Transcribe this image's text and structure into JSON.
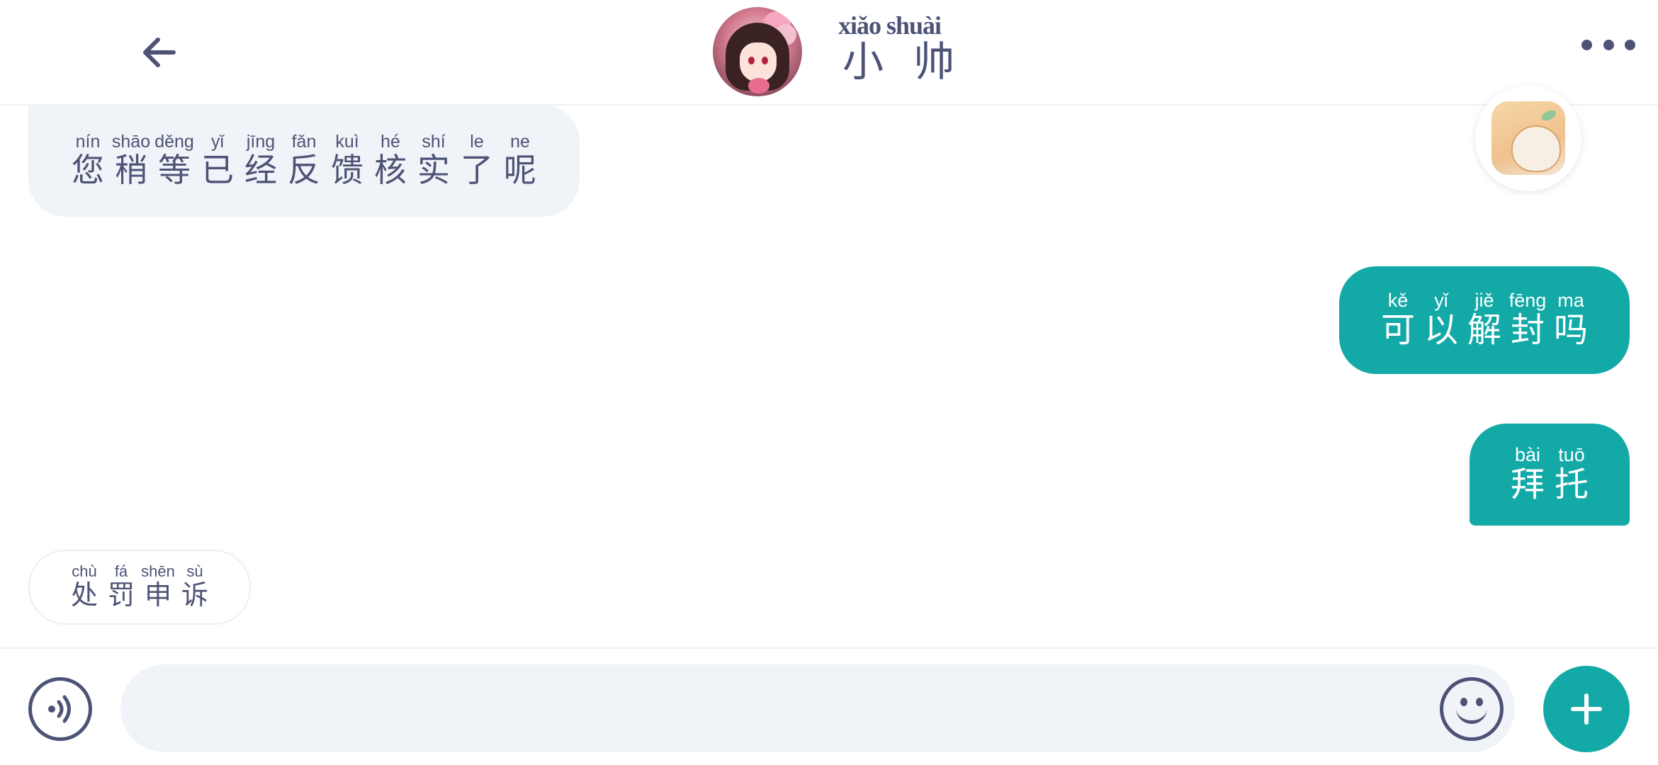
{
  "header": {
    "contact_pinyin": "xiǎo shuài",
    "contact_name": "小 帅",
    "back_icon": "arrow-left-icon",
    "more_icon": "more-horizontal-icon",
    "avatar_icon": "avatar-anime-girl"
  },
  "messages": [
    {
      "direction": "incoming",
      "syllables": [
        {
          "py": "nín",
          "hz": "您"
        },
        {
          "py": "shāo",
          "hz": "稍"
        },
        {
          "py": "děng",
          "hz": "等"
        },
        {
          "py": "yǐ",
          "hz": "已"
        },
        {
          "py": "jīng",
          "hz": "经"
        },
        {
          "py": "fǎn",
          "hz": "反"
        },
        {
          "py": "kuì",
          "hz": "馈"
        },
        {
          "py": "hé",
          "hz": "核"
        },
        {
          "py": "shí",
          "hz": "实"
        },
        {
          "py": "le",
          "hz": "了"
        },
        {
          "py": "ne",
          "hz": "呢"
        }
      ]
    },
    {
      "direction": "outgoing",
      "syllables": [
        {
          "py": "kě",
          "hz": "可"
        },
        {
          "py": "yǐ",
          "hz": "以"
        },
        {
          "py": "jiě",
          "hz": "解"
        },
        {
          "py": "fēng",
          "hz": "封"
        },
        {
          "py": "ma",
          "hz": "吗"
        }
      ]
    },
    {
      "direction": "outgoing",
      "syllables": [
        {
          "py": "bài",
          "hz": "拜"
        },
        {
          "py": "tuō",
          "hz": "托"
        }
      ]
    }
  ],
  "quick_reply": {
    "syllables": [
      {
        "py": "chù",
        "hz": "处"
      },
      {
        "py": "fá",
        "hz": "罚"
      },
      {
        "py": "shēn",
        "hz": "申"
      },
      {
        "py": "sù",
        "hz": "诉"
      }
    ]
  },
  "composer": {
    "input_value": "",
    "input_placeholder": "",
    "voice_icon": "voice-wave-icon",
    "emoji_icon": "smiley-icon",
    "plus_icon": "plus-icon"
  },
  "floating_sticker": {
    "icon": "tiger-sticker-icon"
  },
  "colors": {
    "text": "#4d5376",
    "accent": "#12a9a7",
    "incoming_bg": "#f0f3f7",
    "input_bg": "#f0f3f7"
  }
}
